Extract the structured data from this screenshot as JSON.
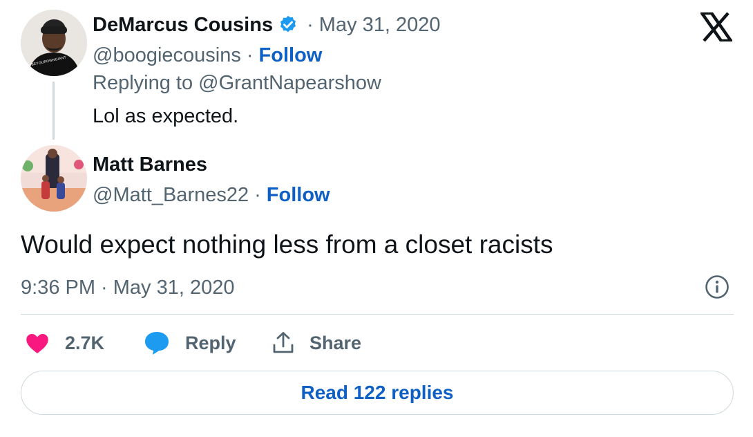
{
  "reply_context": {
    "author_name": "DeMarcus Cousins",
    "separator_date": "· May 31, 2020",
    "handle": "@boogiecousins",
    "dot": "·",
    "follow_label": "Follow",
    "replying_to": "Replying to @GrantNapearshow",
    "text": "Lol as expected.",
    "avatar_text": "#BEYOUROWNGIANT",
    "verified": true
  },
  "tweet": {
    "author_name": "Matt Barnes",
    "handle": "@Matt_Barnes22",
    "dot": "·",
    "follow_label": "Follow",
    "text": "Would expect nothing less from a closet racists",
    "timestamp": "9:36 PM · May 31, 2020"
  },
  "actions": {
    "like_count": "2.7K",
    "reply_label": "Reply",
    "share_label": "Share"
  },
  "footer": {
    "read_replies_label": "Read 122 replies"
  },
  "colors": {
    "like": "#f91880",
    "reply": "#1d9bf0",
    "link": "#0f60c4",
    "verified": "#1d9bf0"
  }
}
